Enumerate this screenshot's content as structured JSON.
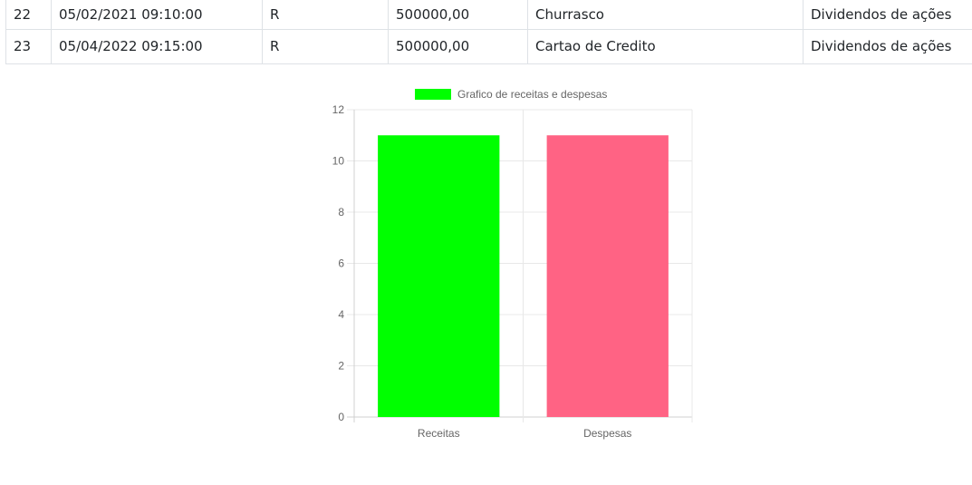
{
  "table": {
    "rows": [
      {
        "id": "22",
        "datetime": "05/02/2021 09:10:00",
        "type": "R",
        "amount": "500000,00",
        "description": "Churrasco",
        "category": "Dividendos de ações"
      },
      {
        "id": "23",
        "datetime": "05/04/2022 09:15:00",
        "type": "R",
        "amount": "500000,00",
        "description": "Cartao de Credito",
        "category": "Dividendos de ações"
      }
    ]
  },
  "chart_data": {
    "type": "bar",
    "legend": {
      "label": "Grafico de receitas e despesas",
      "color": "#00ff00",
      "position": "top"
    },
    "categories": [
      "Receitas",
      "Despesas"
    ],
    "series": [
      {
        "name": "Grafico de receitas e despesas",
        "values": [
          11,
          11
        ],
        "colors": [
          "#00ff00",
          "#ff6384"
        ]
      }
    ],
    "ylim": [
      0,
      12
    ],
    "yticks": [
      "0",
      "2",
      "4",
      "6",
      "8",
      "10",
      "12"
    ],
    "grid": true
  }
}
